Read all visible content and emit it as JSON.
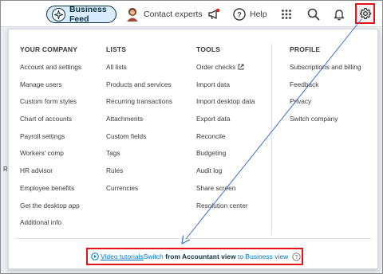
{
  "topbar": {
    "business_feed_label": "Business Feed",
    "contact_experts_label": "Contact experts",
    "help_label": "Help",
    "icons": [
      "sparkle-icon",
      "expert-avatar-icon",
      "megaphone-icon",
      "help-icon",
      "apps-grid-icon",
      "search-icon",
      "bell-icon",
      "gear-icon"
    ]
  },
  "menu": {
    "columns": [
      {
        "heading": "YOUR COMPANY",
        "items": [
          "Account and settings",
          "Manage users",
          "Custom form styles",
          "Chart of accounts",
          "Payroll settings",
          "Workers' comp",
          "HR advisor",
          "Employee benefits",
          "Get the desktop app",
          "Additional info"
        ]
      },
      {
        "heading": "LISTS",
        "items": [
          "All lists",
          "Products and services",
          "Recurring transactions",
          "Attachments",
          "Custom fields",
          "Tags",
          "Rules",
          "Currencies"
        ]
      },
      {
        "heading": "TOOLS",
        "items": [
          "Order checks",
          "Import data",
          "Import desktop data",
          "Export data",
          "Reconcile",
          "Budgeting",
          "Audit log",
          "Share screen",
          "Resolution center"
        ]
      },
      {
        "heading": "PROFILE",
        "items": [
          "Subscriptions and billing",
          "Feedback",
          "Privacy",
          "Switch company"
        ]
      }
    ]
  },
  "footer": {
    "video_tutorials": "Video tutorials",
    "switch_prefix": "Switch ",
    "switch_bold": "from Accountant view",
    "switch_suffix": " to Business view"
  },
  "side_mark": "R",
  "colors": {
    "highlight_red": "#e3141a",
    "link_blue": "#0077c5",
    "dark_teal": "#0d333f",
    "annotation_arrow": "#3b6fc4"
  }
}
